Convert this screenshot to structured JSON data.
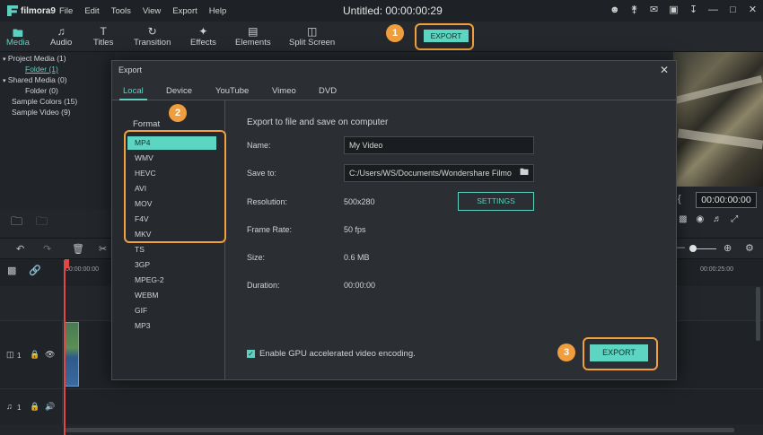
{
  "app": {
    "logo_text": "filmora9",
    "window_title": "Untitled:  00:00:00:29",
    "menu": [
      "File",
      "Edit",
      "Tools",
      "View",
      "Export",
      "Help"
    ]
  },
  "toolbar": {
    "items": [
      {
        "label": "Media",
        "icon": "folder-icon"
      },
      {
        "label": "Audio",
        "icon": "music-note-icon"
      },
      {
        "label": "Titles",
        "icon": "text-icon"
      },
      {
        "label": "Transition",
        "icon": "transition-icon"
      },
      {
        "label": "Effects",
        "icon": "effects-icon"
      },
      {
        "label": "Elements",
        "icon": "image-icon"
      },
      {
        "label": "Split Screen",
        "icon": "split-screen-icon"
      }
    ],
    "export_label": "EXPORT"
  },
  "media_tree": {
    "items": [
      {
        "label": "Project Media (1)"
      },
      {
        "label": "Folder (1)"
      },
      {
        "label": "Shared Media (0)"
      },
      {
        "label": "Folder (0)"
      },
      {
        "label": "Sample Colors (15)"
      },
      {
        "label": "Sample Video (9)"
      }
    ]
  },
  "preview": {
    "timecode": "00:00:00:00"
  },
  "timeline": {
    "ruler_start": "00:00:00:00",
    "ruler_end": "00:00:25:00",
    "tracks": [
      {
        "label": "1",
        "type": "video"
      },
      {
        "label": "1",
        "type": "audio"
      }
    ]
  },
  "dialog": {
    "title": "Export",
    "tabs": [
      "Local",
      "Device",
      "YouTube",
      "Vimeo",
      "DVD"
    ],
    "format_heading": "Format",
    "formats": [
      "MP4",
      "WMV",
      "HEVC",
      "AVI",
      "MOV",
      "F4V",
      "MKV",
      "TS",
      "3GP",
      "MPEG-2",
      "WEBM",
      "GIF",
      "MP3"
    ],
    "selected_format": "MP4",
    "section_title": "Export to file and save on computer",
    "fields": {
      "name_label": "Name:",
      "name_value": "My Video",
      "save_label": "Save to:",
      "save_value": "C:/Users/WS/Documents/Wondershare Filmo",
      "resolution_label": "Resolution:",
      "resolution_value": "500x280",
      "settings_label": "SETTINGS",
      "framerate_label": "Frame Rate:",
      "framerate_value": "50 fps",
      "size_label": "Size:",
      "size_value": "0.6 MB",
      "duration_label": "Duration:",
      "duration_value": "00:00:00"
    },
    "gpu_label": "Enable GPU accelerated video encoding.",
    "gpu_checked": true,
    "export_label": "EXPORT"
  },
  "callouts": [
    "1",
    "2",
    "3"
  ],
  "colors": {
    "accent": "#5cd6c3",
    "highlight": "#f0a03c"
  }
}
